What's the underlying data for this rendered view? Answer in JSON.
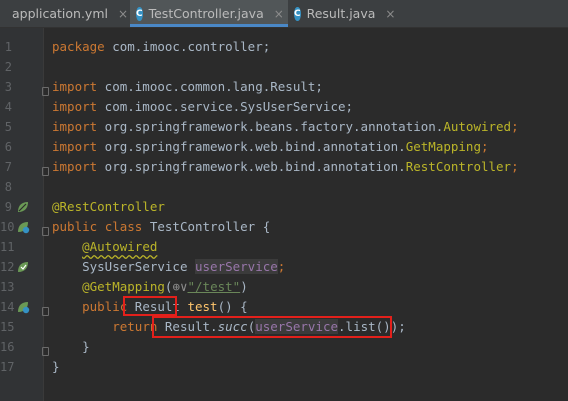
{
  "tabs": [
    {
      "label": "application.yml",
      "icon": "yml-file-icon",
      "active": false
    },
    {
      "label": "TestController.java",
      "icon": "class-file-icon",
      "active": true
    },
    {
      "label": "Result.java",
      "icon": "class-file-icon",
      "active": false
    }
  ],
  "tab_close_glyph": "×",
  "class_icon_letter": "C",
  "line_numbers": [
    "1",
    "2",
    "3",
    "4",
    "5",
    "6",
    "7",
    "8",
    "9",
    "10",
    "11",
    "12",
    "13",
    "14",
    "15",
    "16",
    "17"
  ],
  "code": {
    "l1_kw": "package",
    "l1_pkg": " com.imooc.controller;",
    "l3_kw": "import",
    "l3_pkg": " com.imooc.common.lang.Result;",
    "l4_kw": "import",
    "l4_pkg": " com.imooc.service.SysUserService;",
    "l5_kw": "import",
    "l5_pkg": " org.springframework.beans.factory.annotation.",
    "l5_ann": "Autowired",
    "l5_end": ";",
    "l6_kw": "import",
    "l6_pkg": " org.springframework.web.bind.annotation.",
    "l6_ann": "GetMapping",
    "l6_end": ";",
    "l7_kw": "import",
    "l7_pkg": " org.springframework.web.bind.annotation.",
    "l7_ann": "RestController",
    "l7_end": ";",
    "l9_ann": "@RestController",
    "l10_kw1": "public",
    "l10_kw2": "class",
    "l10_name": " TestController {",
    "l11_ann": "@Autowired",
    "l12_type": "SysUserService ",
    "l12_field": "userService",
    "l12_end": ";",
    "l13_ann": "@GetMapping",
    "l13_open": "(",
    "l13_globe": "⊕∨",
    "l13_str": "\"/test\"",
    "l13_close": ")",
    "l14_kw": "public",
    "l14_type": " Result ",
    "l14_name": "test",
    "l14_end": "() {",
    "l15_kw": "return",
    "l15_cls": "Result.",
    "l15_method": "succ",
    "l15_open": "(",
    "l15_field": "userService",
    "l15_end": ".list());",
    "l16_brace": "}",
    "l17_brace": "}"
  },
  "colors": {
    "keyword": "#cc7832",
    "annotation": "#bbb529",
    "string": "#6a8759",
    "field": "#9876aa",
    "text": "#a9b7c6",
    "highlight_box": "#e3201b",
    "background": "#2b2b2b"
  }
}
